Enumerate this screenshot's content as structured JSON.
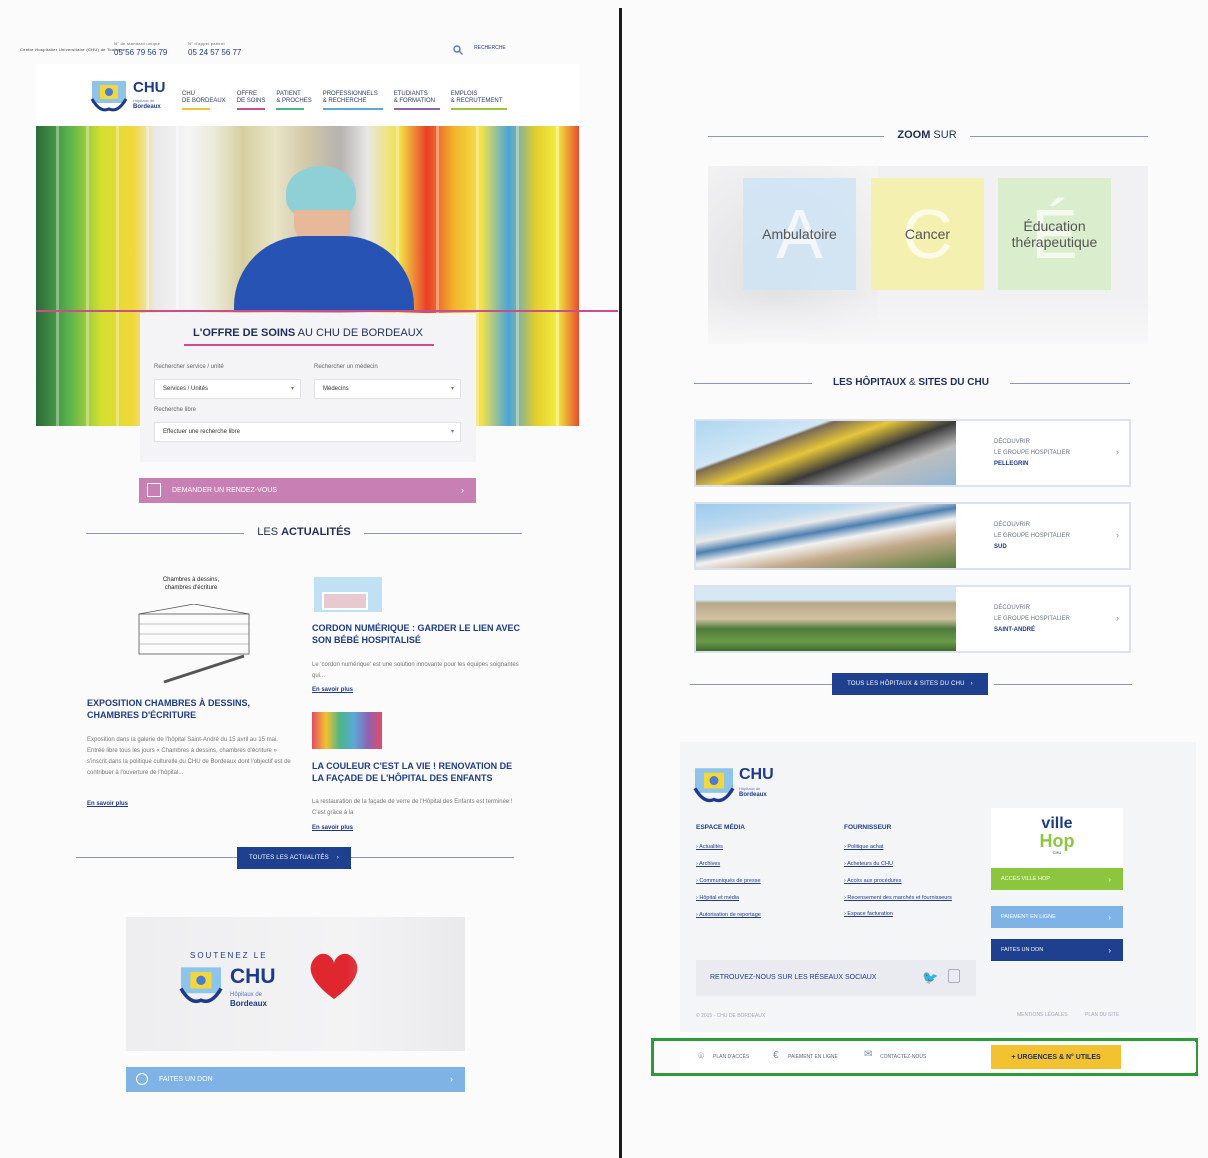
{
  "topbar": {
    "hospital_label": "Centre Hospitalier Universitaire (CHU) de Toulouse",
    "std_label": "N° de standard unique",
    "std_phone": "05 56 79 56 79",
    "patient_label": "N° d'appel patient",
    "patient_phone": "05 24 57 56 77",
    "search_label": "RECHERCHE"
  },
  "logo": {
    "title": "CHU",
    "sub1": "Hôpitaux de",
    "sub2": "Bordeaux"
  },
  "nav": [
    {
      "line1": "CHU",
      "line2": "DE BORDEAUX",
      "color": "#f2c230"
    },
    {
      "line1": "OFFRE",
      "line2": "DE SOINS",
      "color": "#c94f8b"
    },
    {
      "line1": "PATIENT",
      "line2": "& PROCHES",
      "color": "#4bb58a"
    },
    {
      "line1": "PROFESSIONNELS",
      "line2": "& RECHERCHE",
      "color": "#5aa9d6"
    },
    {
      "line1": "ETUDIANTS",
      "line2": "& FORMATION",
      "color": "#8c63b5"
    },
    {
      "line1": "EMPLOIS",
      "line2": "& RECRUTEMENT",
      "color": "#9bc53d"
    }
  ],
  "offer": {
    "title_bold": "L'OFFRE DE SOINS",
    "title_rest": " AU CHU DE BORDEAUX",
    "service_label": "Rechercher service / unité",
    "service_value": "Services / Unités",
    "doctor_label": "Rechercher un médecin",
    "doctor_value": "Médecins",
    "free_label": "Recherche libre",
    "free_value": "Effectuer une recherche libre",
    "rdv_label": "DEMANDER UN RENDEZ-VOUS"
  },
  "news": {
    "title_light": "LES ",
    "title_bold": "ACTUALITÉS",
    "items": [
      {
        "title": "EXPOSITION CHAMBRES À DESSINS, CHAMBRES D'ÉCRITURE",
        "image_caption": "Chambres à dessins, chambres d'écriture",
        "text": "Exposition dans la galerie de l'hôpital Saint-André du 15 avril au 15 mai. Entrée libre tous les jours « Chambres à dessins, chambres d'écriture » s'inscrit dans la politique culturelle du CHU de Bordeaux dont l'objectif est de contribuer à l'ouverture de l'hôpital...",
        "link": "En savoir plus"
      },
      {
        "title": "CORDON NUMÉRIQUE : GARDER LE LIEN AVEC SON BÉBÉ HOSPITALISÉ",
        "text": "Le 'cordon numérique' est une solution innovante pour les équipes soignantes qui...",
        "link": "En savoir plus"
      },
      {
        "title": "LA COULEUR C'EST LA VIE ! RENOVATION DE LA FAÇADE DE L'HÔPITAL DES ENFANTS",
        "text": "La restauration de la façade de verre de l'Hôpital des Enfants est terminée ! C'est grâce à la",
        "link": "En savoir plus"
      }
    ],
    "all_button": "TOUTES LES ACTUALITÉS"
  },
  "donate": {
    "soutenez": "SOUTENEZ LE",
    "chu": "CHU",
    "sub1": "Hôpitaux de",
    "sub2": "Bordeaux",
    "button": "FAITES UN DON"
  },
  "zoom": {
    "title_bold": "ZOOM",
    "title_light": " SUR",
    "tiles": [
      {
        "label": "Ambulatoire",
        "letter": "A",
        "color": "#cfe3f3"
      },
      {
        "label": "Cancer",
        "letter": "C",
        "color": "#f3efa8"
      },
      {
        "label": "Éducation thérapeutique",
        "letter": "É",
        "color": "#d7edc9"
      }
    ]
  },
  "hospitals": {
    "title_bold1": "LES HÔPITAUX",
    "title_amp": " & ",
    "title_bold2": "SITES DU CHU",
    "items": [
      {
        "line1": "DÉCOUVRIR",
        "line2": "LE GROUPE HOSPITALIER",
        "name": "PELLEGRIN"
      },
      {
        "line1": "DÉCOUVRIR",
        "line2": "LE GROUPE HOSPITALIER",
        "name": "SUD"
      },
      {
        "line1": "DÉCOUVRIR",
        "line2": "LE GROUPE HOSPITALIER",
        "name": "SAINT-ANDRÉ"
      }
    ],
    "all_button": "TOUS LES HÔPITAUX & SITES DU CHU"
  },
  "footer": {
    "media_title": "ESPACE MÉDIA",
    "media_links": [
      "Actualités",
      "Archives",
      "Communiqués de presse",
      "Hôpital et média",
      "Autorisation de reportage"
    ],
    "supplier_title": "FOURNISSEUR",
    "supplier_links": [
      "Politique achat",
      "Acheteurs du CHU",
      "Accès aux procédures",
      "Recensement des marchés et fournisseurs",
      "Espace facturation"
    ],
    "villehop": {
      "ville": "ville",
      "hop": "Hop",
      "sub": "CHU"
    },
    "buttons": [
      {
        "label": "ACCÈS VILLE HOP",
        "color": "#8cc63f"
      },
      {
        "label": "PAIEMENT EN LIGNE",
        "color": "#7fb3e6"
      },
      {
        "label": "FAITES UN DON",
        "color": "#1f3f8f"
      }
    ],
    "social": "RETROUVEZ-NOUS SUR LES RÉSEAUX SOCIAUX",
    "copyright": "© 2015 - CHU DE BORDEAUX",
    "legal": "MENTIONS LÉGALES",
    "sitemap": "PLAN DU SITE"
  },
  "bottombar": {
    "access": "PLAN D'ACCÈS",
    "payment": "PAIEMENT EN LIGNE",
    "contact": "CONTACTEZ-NOUS",
    "urgent": "+ URGENCES & N° UTILES",
    "highlight_color": "#2a9d3a"
  }
}
